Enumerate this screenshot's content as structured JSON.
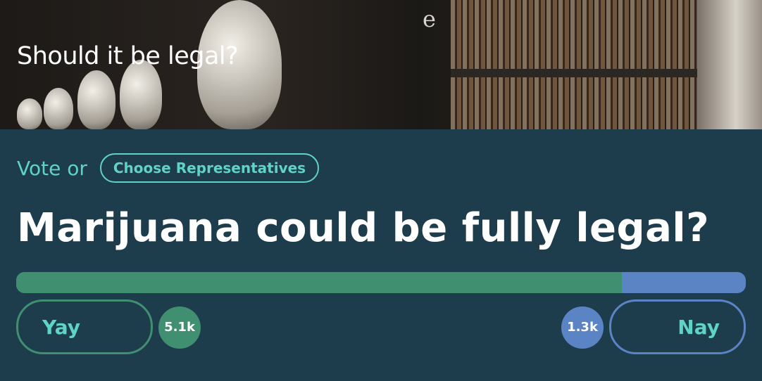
{
  "header": {
    "title": "Should it be legal?",
    "image_glyph": "e"
  },
  "vote_row": {
    "label": "Vote or",
    "representatives_button": "Choose Representatives"
  },
  "question": "Marijuana could be fully legal?",
  "results": {
    "yay_fraction": 0.83,
    "yay_label": "Yay",
    "yay_count": "5.1k",
    "nay_label": "Nay",
    "nay_count": "1.3k"
  },
  "colors": {
    "background": "#1e3d4c",
    "accent_teal": "#5fd3c6",
    "yay_green": "#3f8f70",
    "nay_blue": "#5b84c4"
  }
}
